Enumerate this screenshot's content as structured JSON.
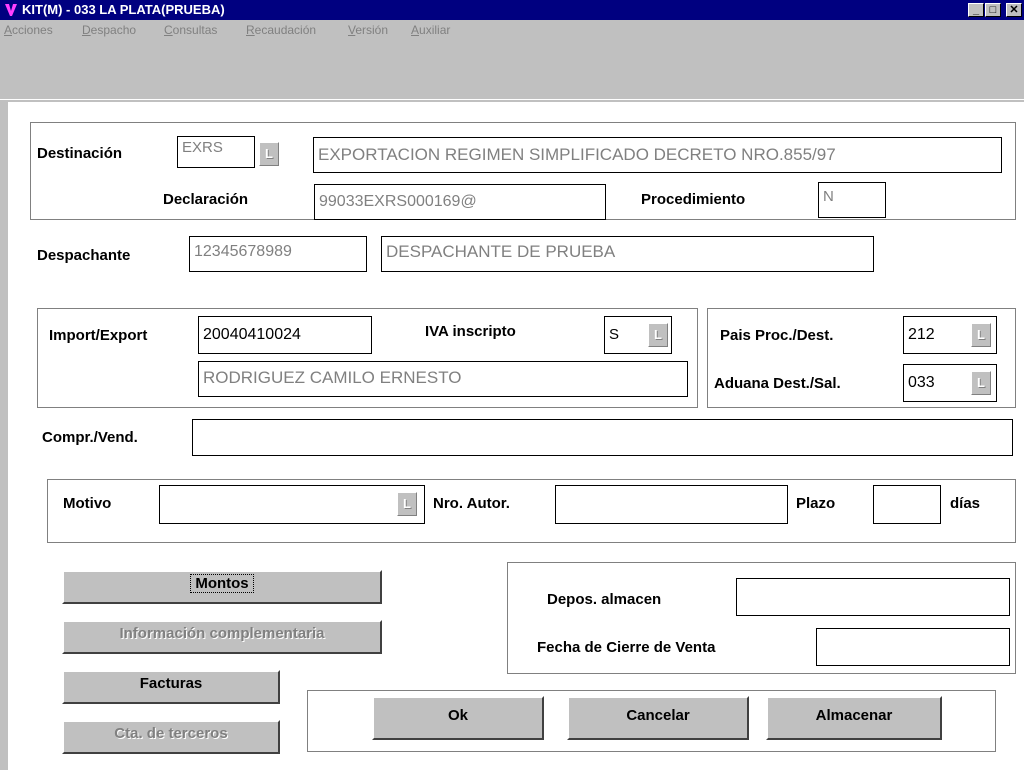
{
  "window": {
    "title": "KIT(M) - 033 LA PLATA(PRUEBA)",
    "controls": {
      "minimize": "_",
      "maximize": "□",
      "close": "✕"
    }
  },
  "menu": {
    "items": [
      {
        "label": "Acciones"
      },
      {
        "label": "Despacho"
      },
      {
        "label": "Consultas"
      },
      {
        "label": "Recaudación"
      },
      {
        "label": "Versión"
      },
      {
        "label": "Auxiliar"
      }
    ]
  },
  "lookup_button_label": "L",
  "destinacion": {
    "label": "Destinación",
    "code": "EXRS",
    "description": "EXPORTACION REGIMEN SIMPLIFICADO DECRETO NRO.855/97",
    "declaracion_label": "Declaración",
    "declaracion": "99033EXRS000169@",
    "procedimiento_label": "Procedimiento",
    "procedimiento": "N"
  },
  "despachante": {
    "label": "Despachante",
    "code": "12345678989",
    "name": "DESPACHANTE DE PRUEBA"
  },
  "import_export": {
    "label": "Import/Export",
    "cuit": "20040410024",
    "iva_label": "IVA inscripto",
    "iva": "S",
    "name": "RODRIGUEZ CAMILO ERNESTO"
  },
  "pais": {
    "pais_label": "Pais Proc./Dest.",
    "pais": "212",
    "aduana_label": "Aduana Dest./Sal.",
    "aduana": "033"
  },
  "comprador": {
    "label": "Compr./Vend.",
    "value": ""
  },
  "motivo": {
    "label": "Motivo",
    "value": "",
    "autor_label": "Nro. Autor.",
    "autor": "",
    "plazo_label": "Plazo",
    "plazo": "",
    "dias_label": "días"
  },
  "buttons": {
    "montos": "Montos",
    "info": "Información complementaria",
    "facturas": "Facturas",
    "terceros": "Cta. de terceros",
    "ok": "Ok",
    "cancelar": "Cancelar",
    "almacenar": "Almacenar"
  },
  "deposito": {
    "depos_label": "Depos. almacen",
    "depos": "",
    "fecha_label": "Fecha de Cierre de Venta",
    "fecha": ""
  }
}
